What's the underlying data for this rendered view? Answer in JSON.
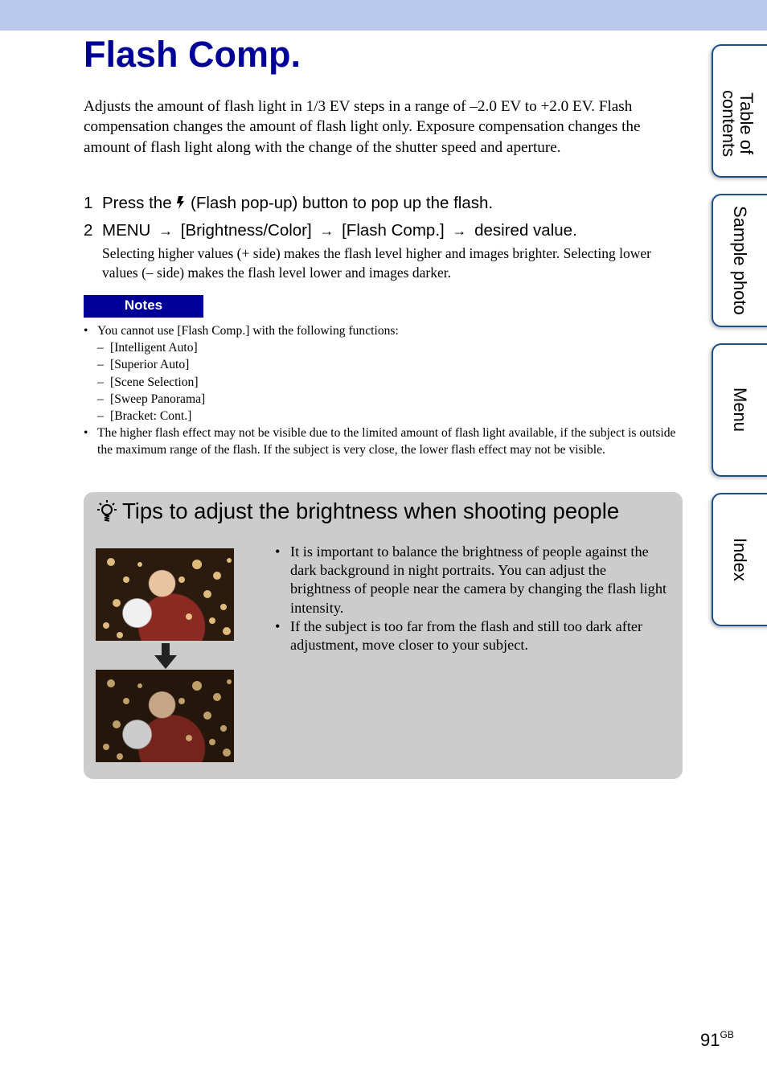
{
  "title": "Flash Comp.",
  "intro": "Adjusts the amount of flash light in 1/3 EV steps in a range of –2.0 EV to +2.0 EV. Flash compensation changes the amount of flash light only. Exposure compensation changes the amount of flash light along with the change of the shutter speed and aperture.",
  "steps": [
    {
      "number": "1",
      "before_icon": "Press the",
      "icon": "flash-icon",
      "after_icon": "(Flash pop-up) button to pop up the flash."
    },
    {
      "number": "2",
      "parts": [
        "MENU",
        "[Brightness/Color]",
        "[Flash Comp.]",
        "desired value."
      ],
      "arrow": "→",
      "description": "Selecting higher values (+ side) makes the flash level higher and images brighter. Selecting lower values (– side) makes the flash level lower and images darker."
    }
  ],
  "notes": {
    "label": "Notes",
    "bullet": "•",
    "dash": "–",
    "items": [
      {
        "text": "You cannot use [Flash Comp.] with the following functions:",
        "subitems": [
          "[Intelligent Auto]",
          "[Superior Auto]",
          "[Scene Selection]",
          "[Sweep Panorama]",
          "[Bracket: Cont.]"
        ]
      },
      {
        "text": "The higher flash effect may not be visible due to the limited amount of flash light available, if the subject is outside the maximum range of the flash. If the subject is very close, the lower flash effect may not be visible."
      }
    ]
  },
  "tips": {
    "icon": "lightbulb-icon",
    "title": "Tips to adjust the brightness when shooting people",
    "images": [
      {
        "name": "photo-before",
        "description": "Boy holding snowman cookie, brighter flash, bokeh background"
      },
      {
        "name": "photo-after",
        "description": "Boy holding snowman cookie, reduced flash, bokeh background"
      }
    ],
    "arrow_icon": "down-arrow-icon",
    "items": [
      "It is important to balance the brightness of people against the dark background in night portraits. You can adjust the brightness of people near the camera by changing the flash light intensity.",
      "If the subject is too far from the flash and still too dark after adjustment, move closer to your subject."
    ]
  },
  "side_tabs": [
    {
      "label": "Table of contents"
    },
    {
      "label": "Sample photo"
    },
    {
      "label": "Menu"
    },
    {
      "label": "Index"
    }
  ],
  "page": {
    "number": "91",
    "suffix": "GB"
  },
  "colors": {
    "title": "#000099",
    "top_band": "#b8c8ea",
    "notes_badge": "#000099",
    "tips_background": "#cccccc",
    "tab_border": "#1f4e8a"
  }
}
